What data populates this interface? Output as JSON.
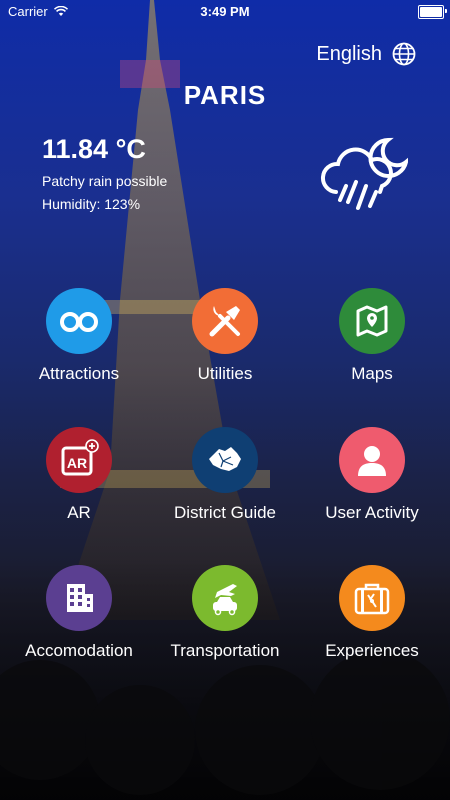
{
  "status_bar": {
    "carrier": "Carrier",
    "time": "3:49 PM"
  },
  "header": {
    "language_label": "English",
    "city_title": "PARIS"
  },
  "weather": {
    "temperature": "11.84 °C",
    "description": "Patchy rain possible",
    "humidity": "Humidity: 123%",
    "icon": "cloud-rain-moon-icon"
  },
  "menu": {
    "items": [
      {
        "label": "Attractions",
        "icon": "binoculars-icon",
        "color": "#1f9be8"
      },
      {
        "label": "Utilities",
        "icon": "tools-icon",
        "color": "#f26d36"
      },
      {
        "label": "Maps",
        "icon": "map-pin-icon",
        "color": "#2e8b3a"
      },
      {
        "label": "AR",
        "icon": "ar-icon",
        "color": "#b0202f"
      },
      {
        "label": "District Guide",
        "icon": "district-map-icon",
        "color": "#0f3f73"
      },
      {
        "label": "User Activity",
        "icon": "user-icon",
        "color": "#ef5b6e"
      },
      {
        "label": "Accomodation",
        "icon": "building-icon",
        "color": "#5b3f91"
      },
      {
        "label": "Transportation",
        "icon": "car-plane-icon",
        "color": "#7cba2e"
      },
      {
        "label": "Experiences",
        "icon": "suitcase-icon",
        "color": "#f48a1d"
      }
    ]
  }
}
